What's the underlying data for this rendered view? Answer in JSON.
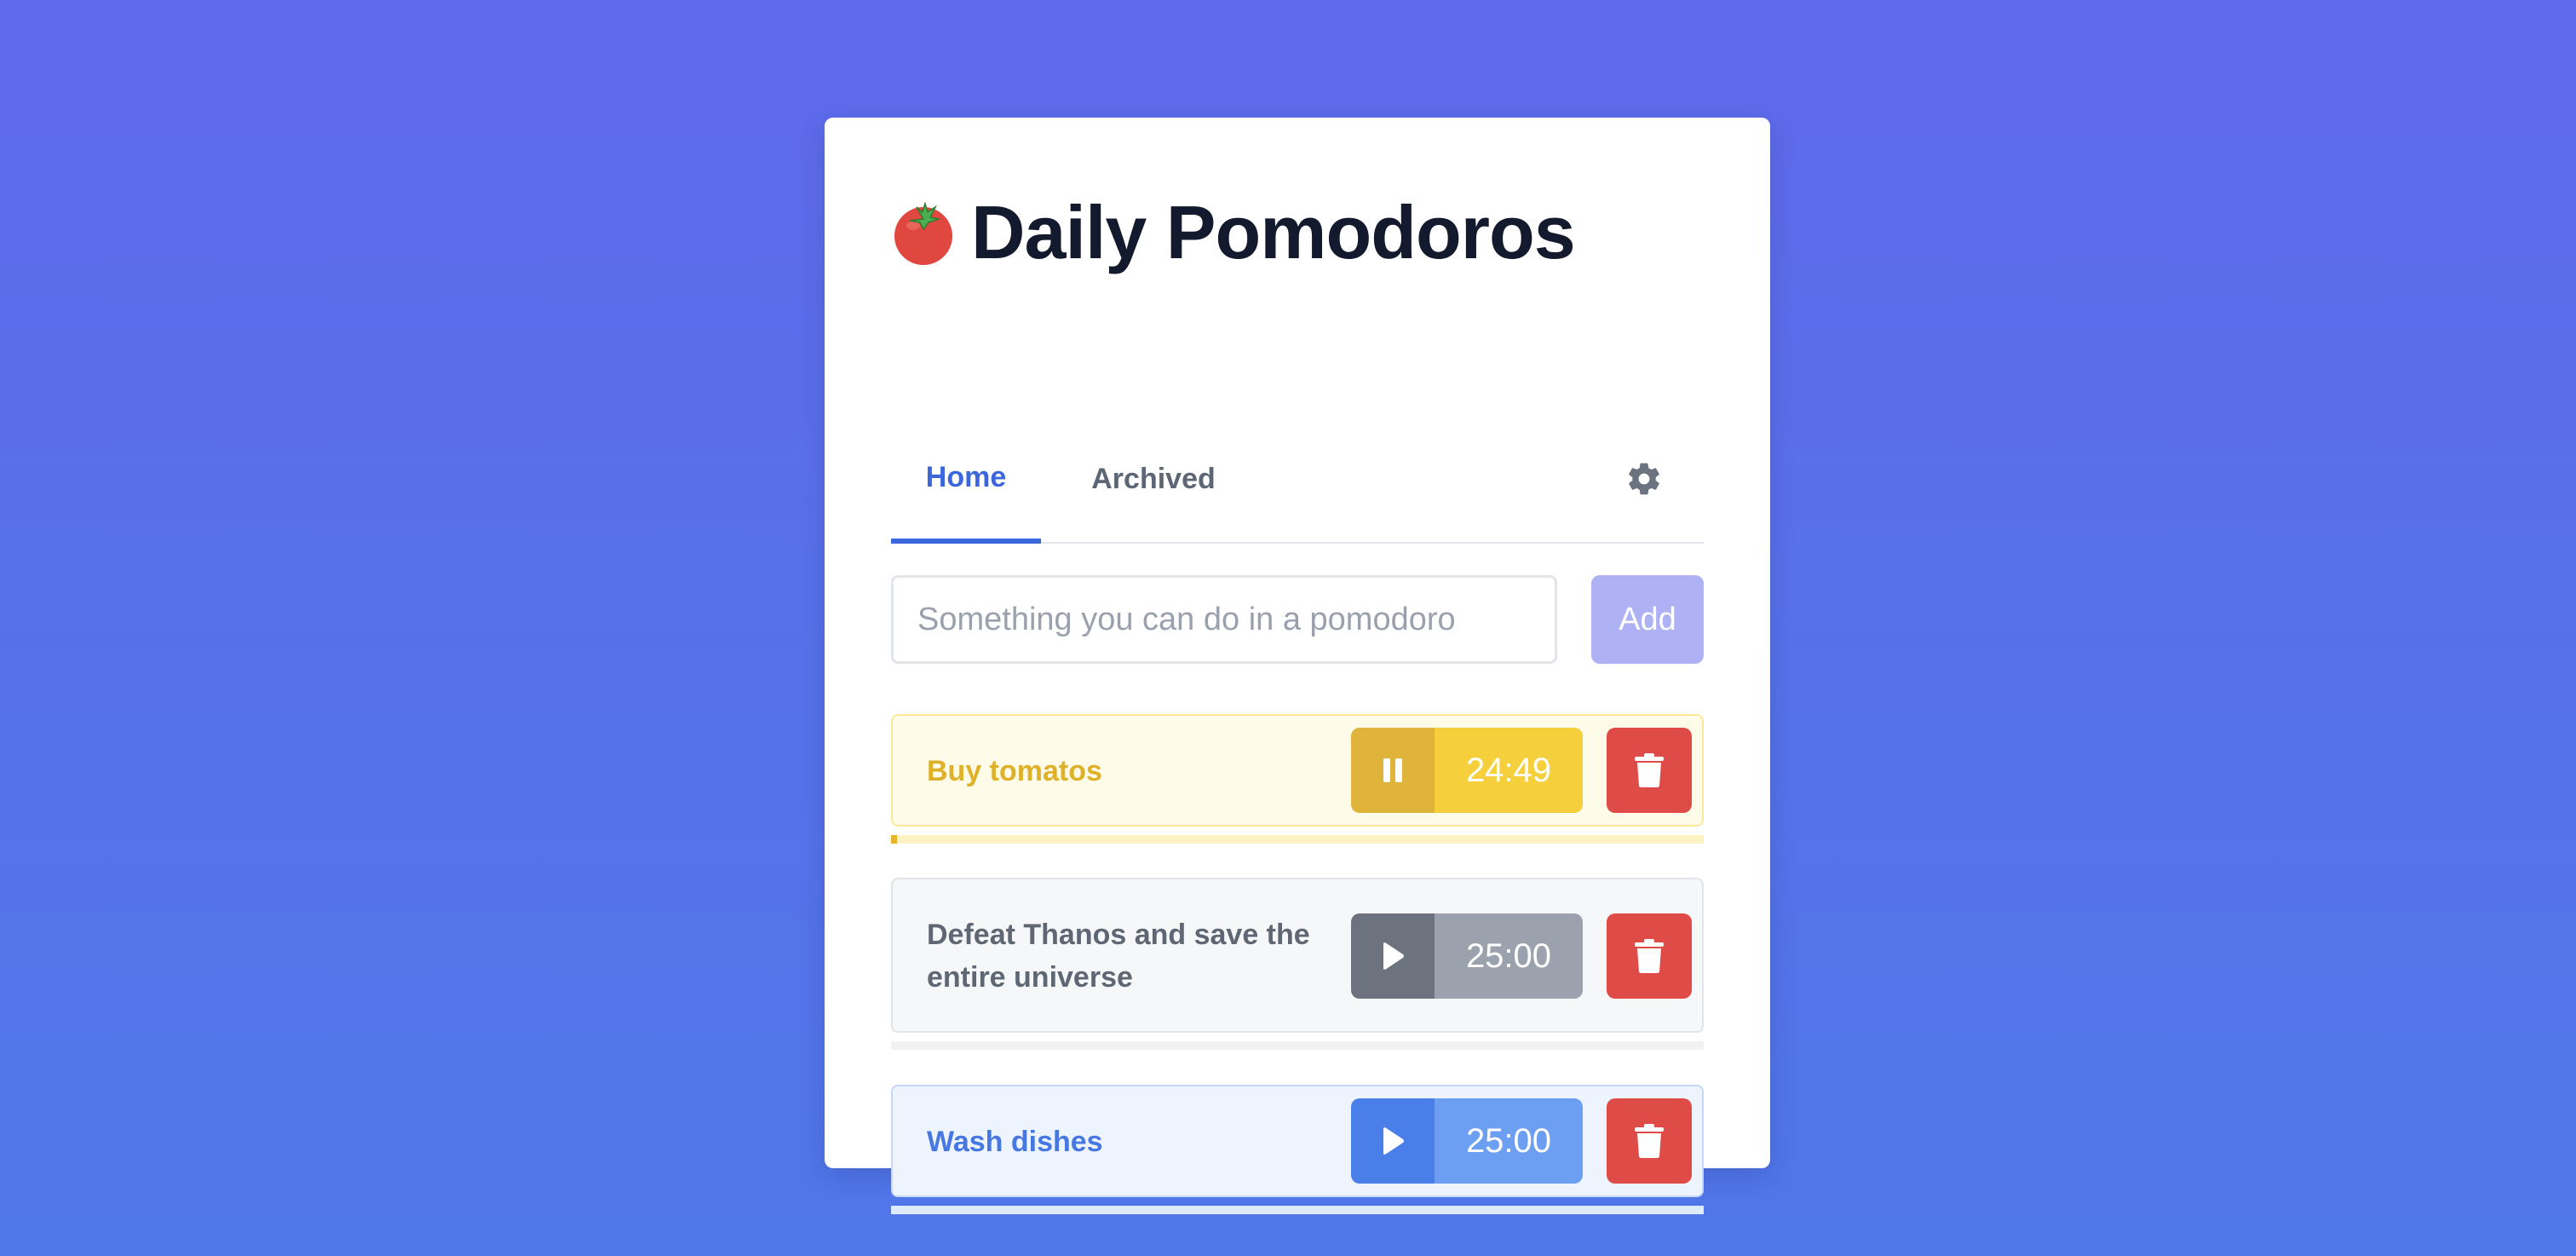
{
  "app": {
    "title": "Daily Pomodoros",
    "logo_icon": "tomato-icon"
  },
  "tabs": [
    {
      "label": "Home",
      "active": true
    },
    {
      "label": "Archived",
      "active": false
    }
  ],
  "settings_icon": "gear-icon",
  "new_task": {
    "value": "",
    "placeholder": "Something you can do in a pomodoro",
    "add_label": "Add"
  },
  "tasks": [
    {
      "name": "Buy tomatos",
      "time": "24:49",
      "state": "running",
      "control_icon": "pause-icon",
      "progress_percent": 0.7,
      "color": "#f5cf3c"
    },
    {
      "name": "Defeat Thanos and save the entire universe",
      "time": "25:00",
      "state": "stopped",
      "control_icon": "play-icon",
      "progress_percent": 0,
      "color": "#9ca2ad"
    },
    {
      "name": "Wash dishes",
      "time": "25:00",
      "state": "stopped",
      "control_icon": "play-icon",
      "progress_percent": 0,
      "color": "#6c9ef1"
    }
  ],
  "delete_icon": "trash-icon",
  "colors": {
    "accent": "#3b66dc",
    "danger": "#df4b46",
    "add_button": "#aeb2f5"
  }
}
